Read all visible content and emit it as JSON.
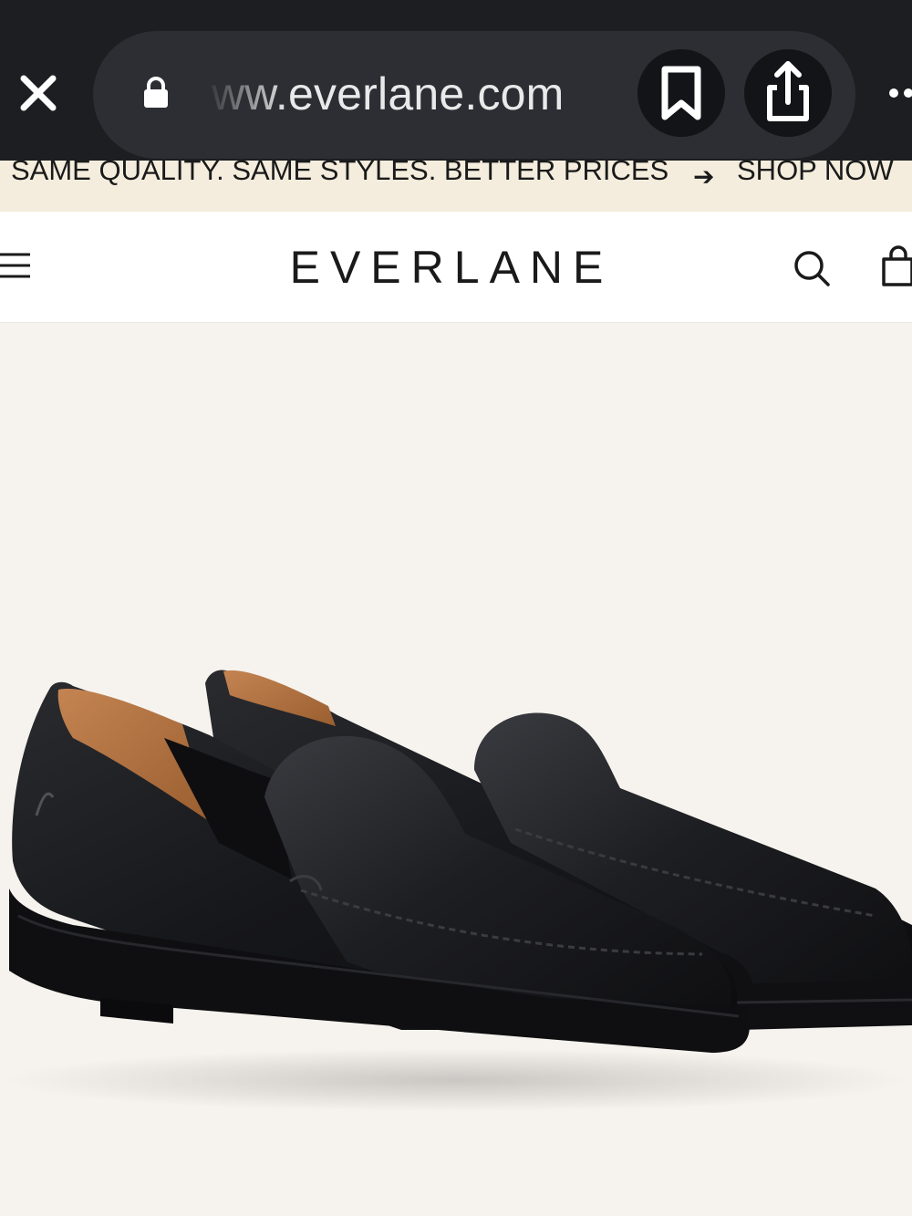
{
  "browser": {
    "url": "ww.everlane.com",
    "close_icon": "close-icon",
    "lock_icon": "lock-icon",
    "bookmark_icon": "bookmark-icon",
    "share_icon": "share-icon",
    "more_icon": "more-dots-icon"
  },
  "promo": {
    "text": "SAME QUALITY. SAME STYLES. BETTER PRICES",
    "arrow": "➔",
    "link": "SHOP NOW",
    "background": "#f4eddd"
  },
  "header": {
    "logo": "EVERLANE",
    "menu_icon": "hamburger-menu-icon",
    "search_icon": "search-icon",
    "bag_icon": "shopping-bag-icon"
  },
  "colors": {
    "browser_chrome": "#1c1e22",
    "url_pill": "#2c2e33",
    "page_background": "#f6f3ee",
    "shoe_leather": "#16171a",
    "shoe_lining": "#b8743f"
  }
}
